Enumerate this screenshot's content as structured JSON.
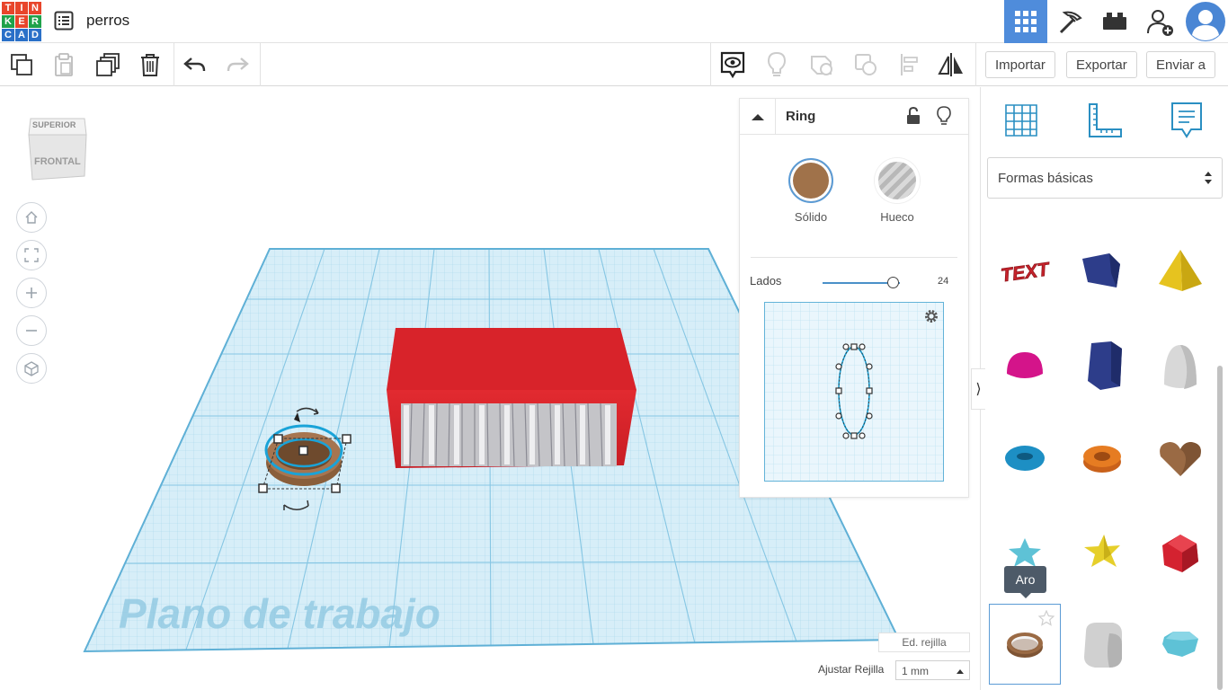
{
  "app": {
    "logo_letters": [
      "T",
      "I",
      "N",
      "K",
      "E",
      "R",
      "C",
      "A",
      "D"
    ],
    "logo_colors": [
      "#e8452b",
      "#e8452b",
      "#e8452b",
      "#1fa24a",
      "#e8452b",
      "#1fa24a",
      "#2a70c8",
      "#2a70c8",
      "#2a70c8"
    ],
    "project_title": "perros"
  },
  "topnav": {
    "items": [
      "3d-design-view-icon",
      "codeblocks-pickaxe-icon",
      "bricks-icon",
      "add-user-icon",
      "user-avatar"
    ],
    "active_color": "#4f8cdb"
  },
  "toolbar": {
    "import_label": "Importar",
    "export_label": "Exportar",
    "send_label": "Enviar a"
  },
  "viewcube": {
    "top_label": "SUPERIOR",
    "front_label": "FRONTAL"
  },
  "workplane": {
    "label": "Plano de trabajo",
    "edit_grid_label": "Ed. rejilla",
    "snap_label": "Ajustar Rejilla",
    "snap_value": "1 mm"
  },
  "inspector": {
    "title": "Ring",
    "solid_label": "Sólido",
    "hole_label": "Hueco",
    "solid_color": "#a0724a",
    "sides_label": "Lados",
    "sides_value": "24",
    "sides_fraction": 0.92
  },
  "library": {
    "category": "Formas básicas",
    "tooltip": "Aro",
    "shapes": [
      {
        "name": "text-shape",
        "label": "TEXT",
        "color": "#c8232c"
      },
      {
        "name": "box-shape",
        "color": "#2d3d8a"
      },
      {
        "name": "pyramid-shape",
        "color": "#e6c31f"
      },
      {
        "name": "half-sphere-shape",
        "color": "#d4148a"
      },
      {
        "name": "polygon-shape",
        "color": "#2d3d8a"
      },
      {
        "name": "paraboloid-shape",
        "color": "#d8d8d8"
      },
      {
        "name": "torus-shape",
        "color": "#1d8fc4"
      },
      {
        "name": "tube-shape",
        "color": "#e67c22"
      },
      {
        "name": "heart-shape",
        "color": "#9a6a44"
      },
      {
        "name": "star-shape-blue",
        "color": "#5ec2d6"
      },
      {
        "name": "star-shape",
        "color": "#e6cf2a"
      },
      {
        "name": "icosahedron-shape",
        "color": "#d42230"
      },
      {
        "name": "ring-shape",
        "color": "#9a6a44"
      },
      {
        "name": "round-box-shape",
        "color": "#d0d0d0"
      },
      {
        "name": "diamond-shape",
        "color": "#5ec2d6"
      }
    ]
  }
}
